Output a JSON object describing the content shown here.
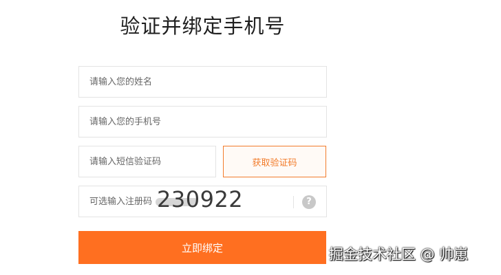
{
  "title": "验证并绑定手机号",
  "form": {
    "name_placeholder": "请输入您的姓名",
    "phone_placeholder": "请输入您的手机号",
    "sms_placeholder": "请输入短信验证码",
    "sms_button_label": "获取验证码",
    "code_placeholder": "可选输入注册码",
    "code_overlay_value": "230922",
    "help_icon_glyph": "?",
    "submit_label": "立即绑定"
  },
  "watermark": "掘金技术社区 @ 帅崽",
  "colors": {
    "accent": "#ff6f20",
    "sms_button_border": "#f27b2a",
    "field_border": "#e3e3e3",
    "help_icon": "#c8c8c8"
  },
  "icons": {
    "help": "help-question-icon"
  }
}
